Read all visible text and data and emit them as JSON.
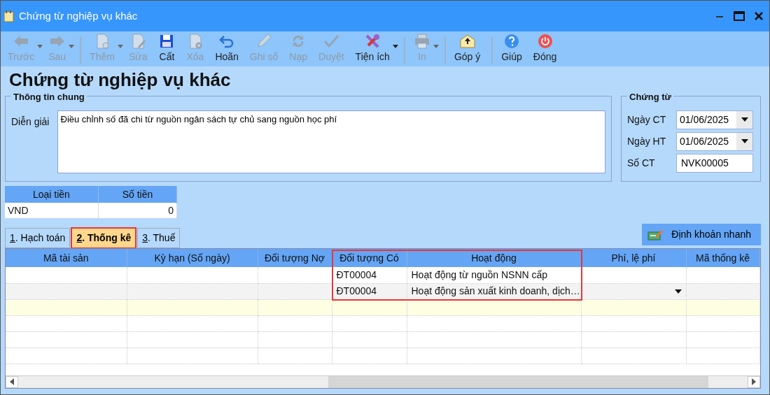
{
  "window": {
    "title": "Chứng từ nghiệp vụ khác"
  },
  "toolbar": [
    {
      "kind": "button",
      "label": "Trước",
      "disabled": true,
      "dropdown": true
    },
    {
      "kind": "button",
      "label": "Sau",
      "disabled": true,
      "dropdown": true
    },
    {
      "kind": "separator"
    },
    {
      "kind": "button",
      "label": "Thêm",
      "disabled": true,
      "dropdown": true
    },
    {
      "kind": "button",
      "label": "Sửa",
      "disabled": true,
      "dropdown": false
    },
    {
      "kind": "button",
      "label": "Cất",
      "disabled": false,
      "dropdown": false
    },
    {
      "kind": "button",
      "label": "Xóa",
      "disabled": true,
      "dropdown": false
    },
    {
      "kind": "button",
      "label": "Hoãn",
      "disabled": false,
      "dropdown": false
    },
    {
      "kind": "button",
      "label": "Ghi sổ",
      "disabled": true,
      "dropdown": false
    },
    {
      "kind": "button",
      "label": "Nạp",
      "disabled": true,
      "dropdown": false
    },
    {
      "kind": "button",
      "label": "Duyệt",
      "disabled": true,
      "dropdown": false
    },
    {
      "kind": "button",
      "label": "Tiện ích",
      "disabled": false,
      "dropdown": true
    },
    {
      "kind": "separator"
    },
    {
      "kind": "button",
      "label": "In",
      "disabled": true,
      "dropdown": true
    },
    {
      "kind": "separator"
    },
    {
      "kind": "button",
      "label": "Góp ý",
      "disabled": false,
      "dropdown": false
    },
    {
      "kind": "separator"
    },
    {
      "kind": "button",
      "label": "Giúp",
      "disabled": false,
      "dropdown": false
    },
    {
      "kind": "button",
      "label": "Đóng",
      "disabled": false,
      "dropdown": false
    }
  ],
  "heading": "Chứng từ nghiệp vụ khác",
  "general_info": {
    "title": "Thông tin chung",
    "description_label": "Diễn giải",
    "description": "Điều chỉnh số đã chi từ nguồn ngân sách tự chủ sang nguồn học phí"
  },
  "voucher": {
    "title": "Chứng từ",
    "fields": [
      {
        "kind": "date",
        "label": "Ngày CT",
        "value": "01/06/2025"
      },
      {
        "kind": "date",
        "label": "Ngày HT",
        "value": "01/06/2025"
      },
      {
        "kind": "text",
        "label": "Số CT",
        "value": "NVK00005"
      }
    ]
  },
  "currency_table": {
    "columns": [
      "Loại tiền",
      "Số tiền"
    ],
    "rows": [
      [
        "VND",
        "0"
      ]
    ]
  },
  "tabs": [
    {
      "label": "1. Hạch toán",
      "selected": false,
      "highlighted": false
    },
    {
      "label": "2. Thống kê",
      "selected": true,
      "highlighted": true
    },
    {
      "label": "3. Thuế",
      "selected": false,
      "highlighted": false
    }
  ],
  "quick_entry_button": "Định khoản nhanh",
  "grid": {
    "columns": [
      {
        "label": "Mã tài sản",
        "highlighted": false
      },
      {
        "label": "Kỳ hạn (Số ngày)",
        "highlighted": false
      },
      {
        "label": "Đối tượng Nợ",
        "highlighted": false
      },
      {
        "label": "Đối tượng Có",
        "highlighted": true
      },
      {
        "label": "Hoạt động",
        "highlighted": true
      },
      {
        "label": "Phí, lệ phí",
        "highlighted": false
      },
      {
        "label": "Mã thống kê",
        "highlighted": false
      }
    ],
    "rows": [
      {
        "cells": [
          null,
          null,
          null,
          "ĐT00004",
          "Hoạt động từ nguồn NSNN cấp",
          null,
          null
        ],
        "selected": false
      },
      {
        "cells": [
          null,
          null,
          null,
          "ĐT00004",
          "Hoạt động sản xuất kinh doanh, dịch…",
          null,
          null
        ],
        "selected": true
      }
    ]
  }
}
